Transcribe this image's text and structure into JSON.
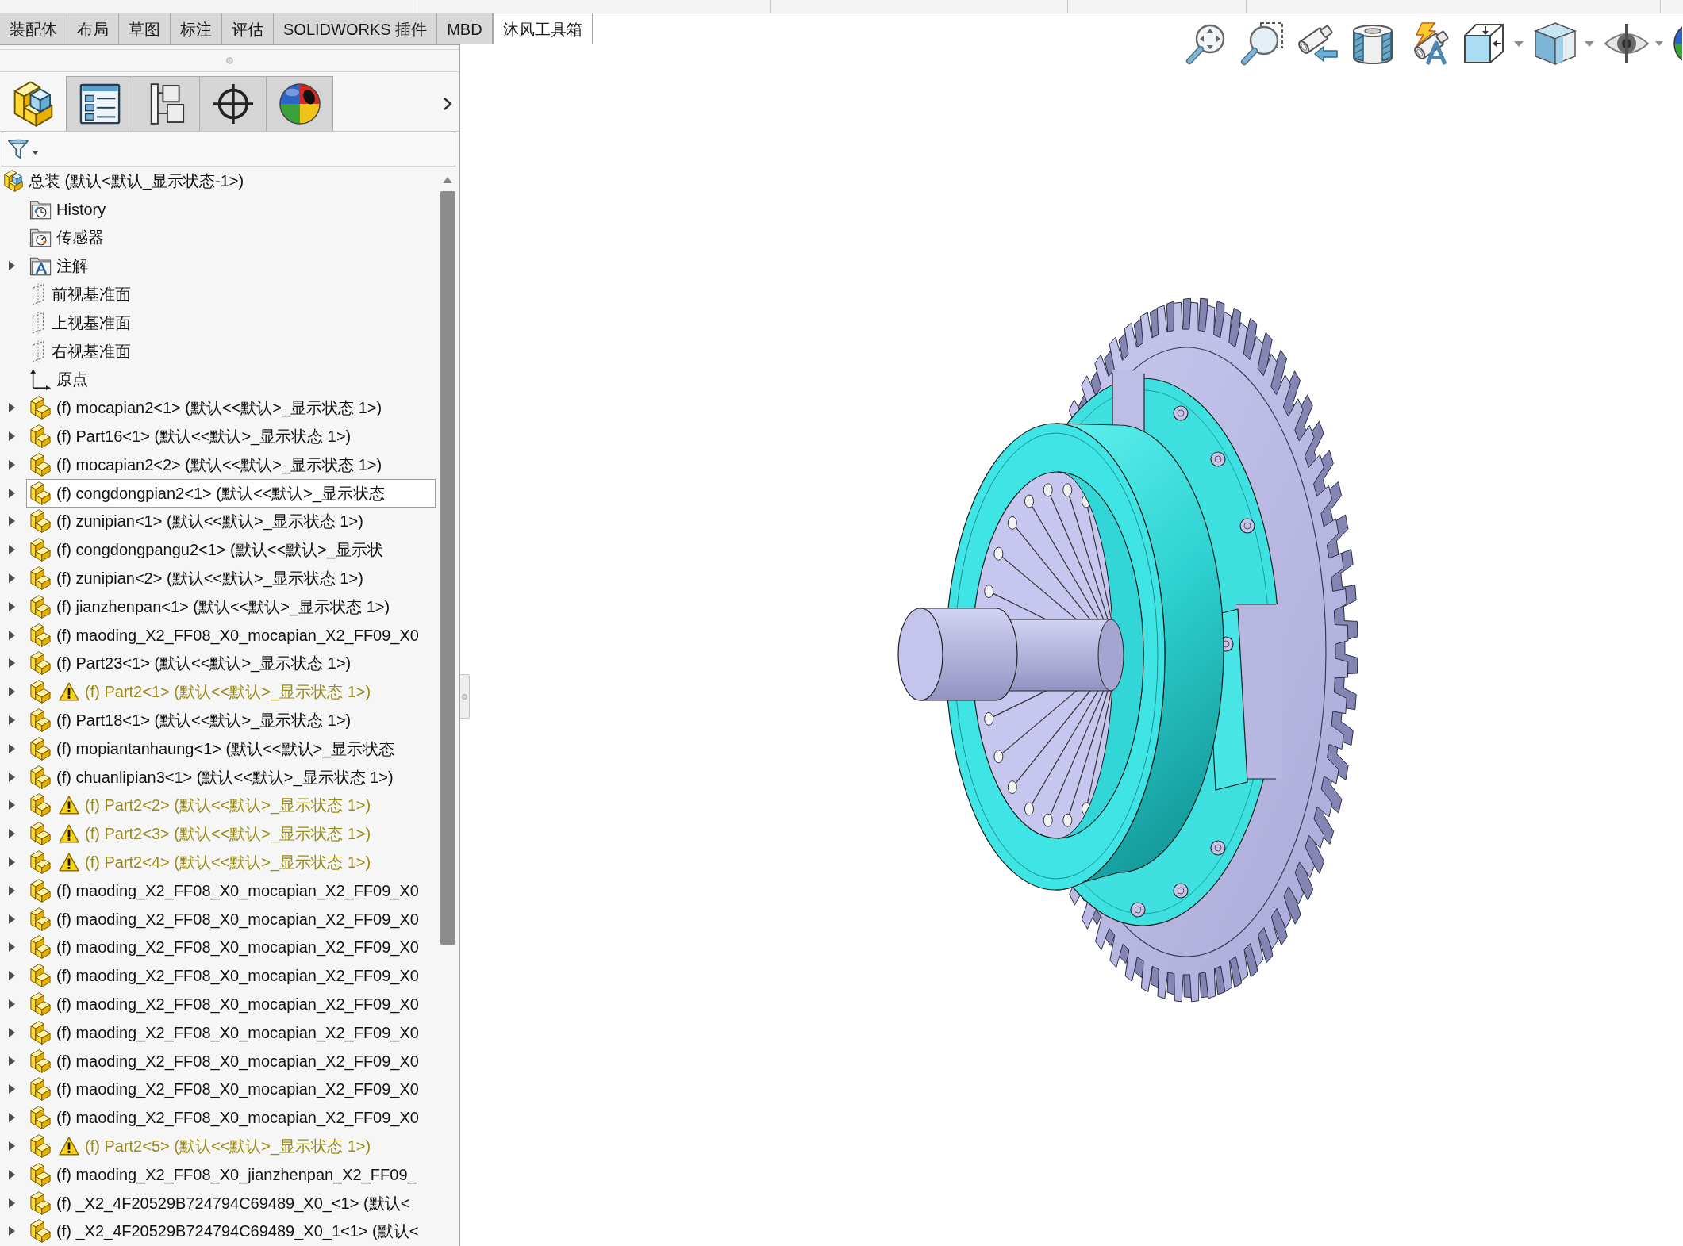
{
  "command_tabs": [
    {
      "label": "装配体",
      "selected": false
    },
    {
      "label": "布局",
      "selected": false
    },
    {
      "label": "草图",
      "selected": false
    },
    {
      "label": "标注",
      "selected": false
    },
    {
      "label": "评估",
      "selected": false
    },
    {
      "label": "SOLIDWORKS 插件",
      "selected": false
    },
    {
      "label": "MBD",
      "selected": false
    },
    {
      "label": "沐风工具箱",
      "selected": true
    }
  ],
  "manager_tabs": [
    {
      "kind": "features",
      "selected": true
    },
    {
      "kind": "properties",
      "selected": false
    },
    {
      "kind": "configurations",
      "selected": false
    },
    {
      "kind": "dimxpert",
      "selected": false
    },
    {
      "kind": "display",
      "selected": false
    }
  ],
  "feature_tree": {
    "root": {
      "kind": "assembly",
      "label": "总装 (默认<默认_显示状态-1>)",
      "selected": false,
      "children": [
        {
          "kind": "history",
          "label": "History",
          "expandable": false,
          "warning": false,
          "selected": false
        },
        {
          "kind": "sensors",
          "label": "传感器",
          "expandable": false,
          "warning": false,
          "selected": false
        },
        {
          "kind": "annotations",
          "label": "注解",
          "expandable": true,
          "warning": false,
          "selected": false
        },
        {
          "kind": "plane",
          "label": "前视基准面",
          "expandable": false,
          "warning": false,
          "selected": false
        },
        {
          "kind": "plane",
          "label": "上视基准面",
          "expandable": false,
          "warning": false,
          "selected": false
        },
        {
          "kind": "plane",
          "label": "右视基准面",
          "expandable": false,
          "warning": false,
          "selected": false
        },
        {
          "kind": "origin",
          "label": "原点",
          "expandable": false,
          "warning": false,
          "selected": false
        },
        {
          "kind": "part",
          "label": "(f) mocapian2<1> (默认<<默认>_显示状态 1>)",
          "expandable": true,
          "warning": false,
          "selected": false
        },
        {
          "kind": "part",
          "label": "(f) Part16<1> (默认<<默认>_显示状态 1>)",
          "expandable": true,
          "warning": false,
          "selected": false
        },
        {
          "kind": "part",
          "label": "(f) mocapian2<2> (默认<<默认>_显示状态 1>)",
          "expandable": true,
          "warning": false,
          "selected": false
        },
        {
          "kind": "part",
          "label": "(f) congdongpian2<1> (默认<<默认>_显示状态",
          "expandable": true,
          "warning": false,
          "selected": true
        },
        {
          "kind": "part",
          "label": "(f) zunipian<1> (默认<<默认>_显示状态 1>)",
          "expandable": true,
          "warning": false,
          "selected": false
        },
        {
          "kind": "part",
          "label": "(f) congdongpangu2<1> (默认<<默认>_显示状",
          "expandable": true,
          "warning": false,
          "selected": false
        },
        {
          "kind": "part",
          "label": "(f) zunipian<2> (默认<<默认>_显示状态 1>)",
          "expandable": true,
          "warning": false,
          "selected": false
        },
        {
          "kind": "part",
          "label": "(f) jianzhenpan<1> (默认<<默认>_显示状态 1>)",
          "expandable": true,
          "warning": false,
          "selected": false
        },
        {
          "kind": "part",
          "label": "(f) maoding_X2_FF08_X0_mocapian_X2_FF09_X0",
          "expandable": true,
          "warning": false,
          "selected": false
        },
        {
          "kind": "part",
          "label": "(f) Part23<1> (默认<<默认>_显示状态 1>)",
          "expandable": true,
          "warning": false,
          "selected": false
        },
        {
          "kind": "part",
          "label": "(f) Part2<1> (默认<<默认>_显示状态 1>)",
          "expandable": true,
          "warning": true,
          "selected": false
        },
        {
          "kind": "part",
          "label": "(f) Part18<1> (默认<<默认>_显示状态 1>)",
          "expandable": true,
          "warning": false,
          "selected": false
        },
        {
          "kind": "part",
          "label": "(f) mopiantanhaung<1> (默认<<默认>_显示状态",
          "expandable": true,
          "warning": false,
          "selected": false
        },
        {
          "kind": "part",
          "label": "(f) chuanlipian3<1> (默认<<默认>_显示状态 1>)",
          "expandable": true,
          "warning": false,
          "selected": false
        },
        {
          "kind": "part",
          "label": "(f) Part2<2> (默认<<默认>_显示状态 1>)",
          "expandable": true,
          "warning": true,
          "selected": false
        },
        {
          "kind": "part",
          "label": "(f) Part2<3> (默认<<默认>_显示状态 1>)",
          "expandable": true,
          "warning": true,
          "selected": false
        },
        {
          "kind": "part",
          "label": "(f) Part2<4> (默认<<默认>_显示状态 1>)",
          "expandable": true,
          "warning": true,
          "selected": false
        },
        {
          "kind": "part",
          "label": "(f) maoding_X2_FF08_X0_mocapian_X2_FF09_X0",
          "expandable": true,
          "warning": false,
          "selected": false
        },
        {
          "kind": "part",
          "label": "(f) maoding_X2_FF08_X0_mocapian_X2_FF09_X0",
          "expandable": true,
          "warning": false,
          "selected": false
        },
        {
          "kind": "part",
          "label": "(f) maoding_X2_FF08_X0_mocapian_X2_FF09_X0",
          "expandable": true,
          "warning": false,
          "selected": false
        },
        {
          "kind": "part",
          "label": "(f) maoding_X2_FF08_X0_mocapian_X2_FF09_X0",
          "expandable": true,
          "warning": false,
          "selected": false
        },
        {
          "kind": "part",
          "label": "(f) maoding_X2_FF08_X0_mocapian_X2_FF09_X0",
          "expandable": true,
          "warning": false,
          "selected": false
        },
        {
          "kind": "part",
          "label": "(f) maoding_X2_FF08_X0_mocapian_X2_FF09_X0",
          "expandable": true,
          "warning": false,
          "selected": false
        },
        {
          "kind": "part",
          "label": "(f) maoding_X2_FF08_X0_mocapian_X2_FF09_X0",
          "expandable": true,
          "warning": false,
          "selected": false
        },
        {
          "kind": "part",
          "label": "(f) maoding_X2_FF08_X0_mocapian_X2_FF09_X0",
          "expandable": true,
          "warning": false,
          "selected": false
        },
        {
          "kind": "part",
          "label": "(f) maoding_X2_FF08_X0_mocapian_X2_FF09_X0",
          "expandable": true,
          "warning": false,
          "selected": false
        },
        {
          "kind": "part",
          "label": "(f) Part2<5> (默认<<默认>_显示状态 1>)",
          "expandable": true,
          "warning": true,
          "selected": false
        },
        {
          "kind": "part",
          "label": "(f) maoding_X2_FF08_X0_jianzhenpan_X2_FF09_",
          "expandable": true,
          "warning": false,
          "selected": false
        },
        {
          "kind": "part",
          "label": "(f) _X2_4F20529B724794C69489_X0_<1> (默认<",
          "expandable": true,
          "warning": false,
          "selected": false
        },
        {
          "kind": "part",
          "label": "(f) _X2_4F20529B724794C69489_X0_1<1> (默认<",
          "expandable": true,
          "warning": false,
          "selected": false
        }
      ]
    }
  }
}
